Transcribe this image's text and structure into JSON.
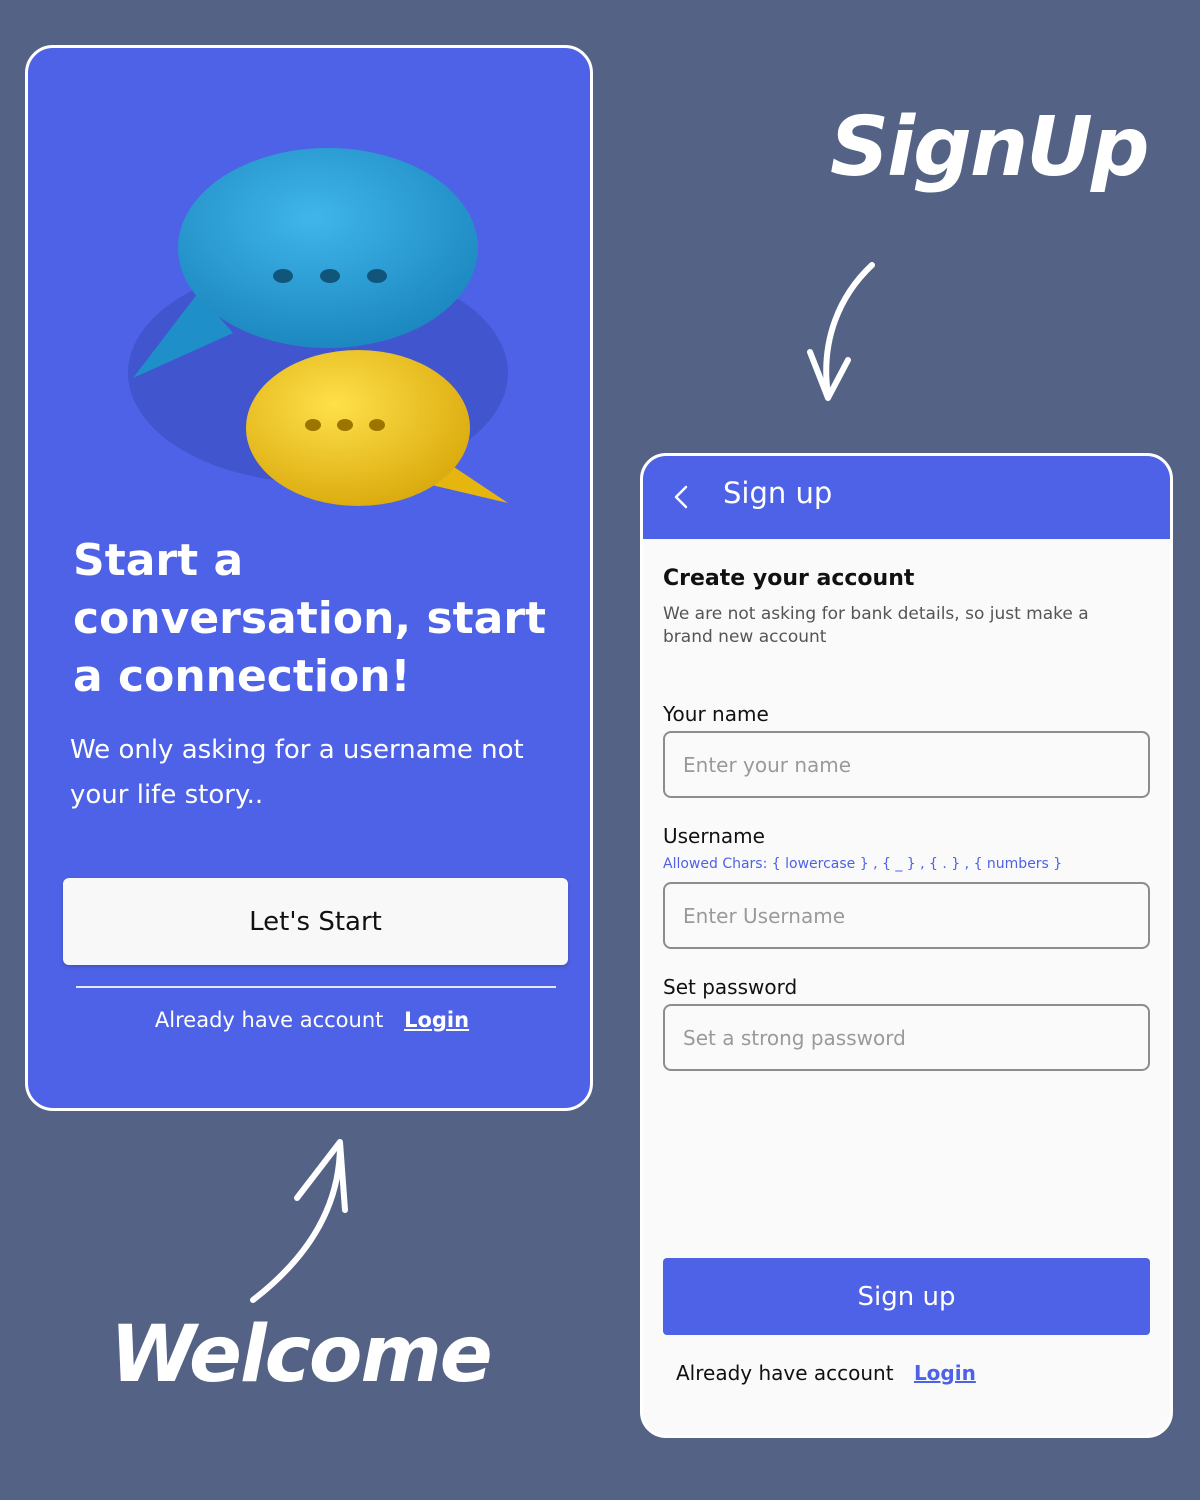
{
  "captions": {
    "signup": "SignUp",
    "welcome": "Welcome"
  },
  "welcome": {
    "title": "Start a conversation, start a connection!",
    "subtitle": "We only asking for a username not your life story..",
    "start_button": "Let's Start",
    "footer_text": "Already have account",
    "login_link": "Login"
  },
  "signup": {
    "appbar_title": "Sign up",
    "heading": "Create your account",
    "description": "We are not asking for bank details, so just make a brand new account",
    "name": {
      "label": "Your name",
      "placeholder": "Enter your name",
      "value": ""
    },
    "username": {
      "label": "Username",
      "hint": "Allowed Chars: { lowercase } , { _ } , { . } , { numbers }",
      "placeholder": "Enter Username",
      "value": ""
    },
    "password": {
      "label": "Set password",
      "placeholder": "Set a strong password",
      "value": ""
    },
    "submit_button": "Sign up",
    "footer_text": "Already have account",
    "login_link": "Login"
  },
  "colors": {
    "background": "#536285",
    "accent": "#4d62e6",
    "bubble_blue": "#2aa0d8",
    "bubble_yellow": "#f2cc1a"
  },
  "icons": [
    "chat-bubble-blue",
    "chat-bubble-yellow",
    "back-chevron-icon",
    "curved-arrow-icon"
  ]
}
